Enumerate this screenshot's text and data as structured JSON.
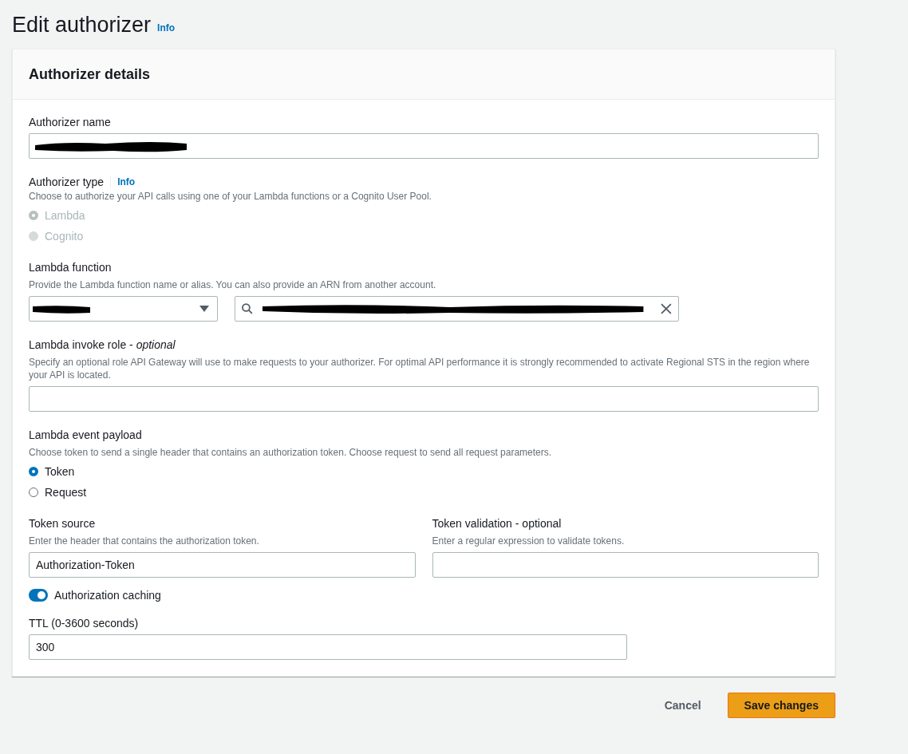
{
  "page": {
    "title": "Edit authorizer",
    "info_link": "Info"
  },
  "card": {
    "title": "Authorizer details"
  },
  "authorizer_name": {
    "label": "Authorizer name",
    "redacted": true
  },
  "authorizer_type": {
    "label": "Authorizer type",
    "info_link": "Info",
    "description": "Choose to authorize your API calls using one of your Lambda functions or a Cognito User Pool.",
    "options": [
      {
        "label": "Lambda",
        "selected": true,
        "disabled": true
      },
      {
        "label": "Cognito",
        "selected": false,
        "disabled": true
      }
    ]
  },
  "lambda_function": {
    "label": "Lambda function",
    "description": "Provide the Lambda function name or alias. You can also provide an ARN from another account.",
    "region_select": {
      "redacted": true
    },
    "function_search": {
      "redacted": true
    }
  },
  "invoke_role": {
    "label": "Lambda invoke role - *optional*",
    "description": "Specify an optional role API Gateway will use to make requests to your authorizer. For optimal API performance it is strongly recommended to activate Regional STS in the region where your API is located."
  },
  "event_payload": {
    "label": "Lambda event payload",
    "description": "Choose token to send a single header that contains an authorization token. Choose request to send all request parameters.",
    "options": [
      {
        "label": "Token",
        "selected": true,
        "disabled": false
      },
      {
        "label": "Request",
        "selected": false,
        "disabled": false
      }
    ]
  },
  "token_source": {
    "label": "Token source",
    "description": "Enter the header that contains the authorization token.",
    "value": "Authorization-Token"
  },
  "token_validation": {
    "label": "Token validation - optional",
    "description": "Enter a regular expression to validate tokens."
  },
  "caching": {
    "label": "Authorization caching",
    "on": true
  },
  "ttl": {
    "label": "TTL (0-3600 seconds)",
    "value": "300"
  },
  "buttons": [
    {
      "label": "Cancel",
      "kind": "link"
    },
    {
      "label": "Save changes",
      "kind": "primary"
    }
  ]
}
